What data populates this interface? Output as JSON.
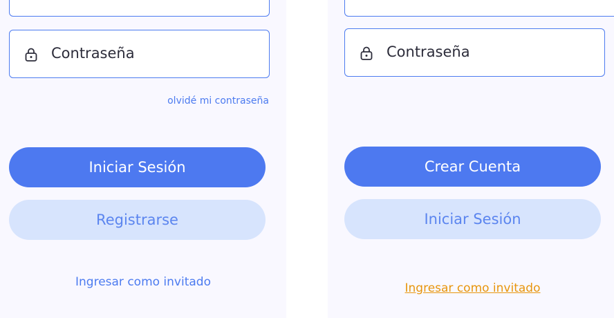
{
  "left": {
    "password_placeholder": "Contraseña",
    "forgot_password": "olvidé mi contraseña",
    "primary_button": "Iniciar Sesión",
    "secondary_button": "Registrarse",
    "guest_link": "Ingresar como invitado"
  },
  "right": {
    "password_placeholder": "Contraseña",
    "primary_button": "Crear Cuenta",
    "secondary_button": "Iniciar Sesión",
    "guest_link": "Ingresar como invitado"
  },
  "colors": {
    "accent": "#4d79f0",
    "secondary_bg": "#d7e4fd",
    "guest_link_highlight": "#e8950c",
    "screen_bg": "#f9f8ff"
  },
  "icons": [
    "lock-icon"
  ]
}
